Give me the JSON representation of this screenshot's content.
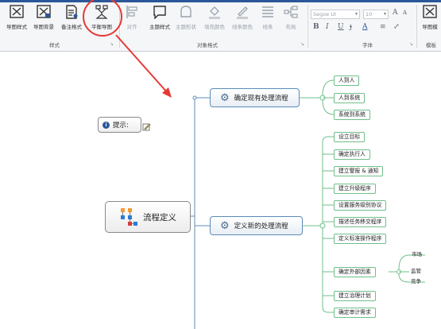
{
  "ribbon": {
    "buttons": [
      {
        "id": "map-style",
        "label": "导图样式"
      },
      {
        "id": "map-background",
        "label": "导图背景"
      },
      {
        "id": "note-format",
        "label": "备注格式"
      },
      {
        "id": "balance-map",
        "label": "平衡导图"
      },
      {
        "id": "align",
        "label": "对齐"
      },
      {
        "id": "topic-style",
        "label": "主题样式"
      },
      {
        "id": "topic-shape",
        "label": "主题形状"
      },
      {
        "id": "fill-color",
        "label": "填充颜色"
      },
      {
        "id": "line-color",
        "label": "线条颜色"
      },
      {
        "id": "line",
        "label": "线条"
      },
      {
        "id": "layout",
        "label": "布局"
      },
      {
        "id": "map-template",
        "label": "导图模"
      }
    ],
    "groups": {
      "style": "样式",
      "object_format": "对象格式",
      "font": "字体",
      "template": "模板"
    },
    "font": {
      "family": "Segoe UI",
      "size": "10"
    },
    "format_buttons": [
      "B",
      "I",
      "U",
      "ɟ",
      "A",
      "≡",
      "⤢"
    ],
    "size_buttons": [
      "A",
      "A"
    ]
  },
  "tip": {
    "label": "提示:"
  },
  "central": {
    "label": "流程定义"
  },
  "branches": [
    {
      "label": "确定现有处理流程",
      "children": [
        "人到人",
        "人到系统",
        "系统到系统"
      ]
    },
    {
      "label": "定义新的处理流程",
      "children": [
        "设立目标",
        "确定执行人",
        "建立警报 & 通知",
        "建立升级程序",
        "设置服务级别协议",
        "描述任务移交程序",
        "定义标准操作程序",
        "确定外部因素",
        "建立治理计划",
        "确定审计需求"
      ]
    }
  ],
  "external_factors": [
    "市场",
    "监管",
    "竞争"
  ],
  "colors": {
    "accent": "#2b579a",
    "highlight": "#e53935",
    "branch_line": "#5b8bb8",
    "sub_line": "#6fbf8a"
  }
}
